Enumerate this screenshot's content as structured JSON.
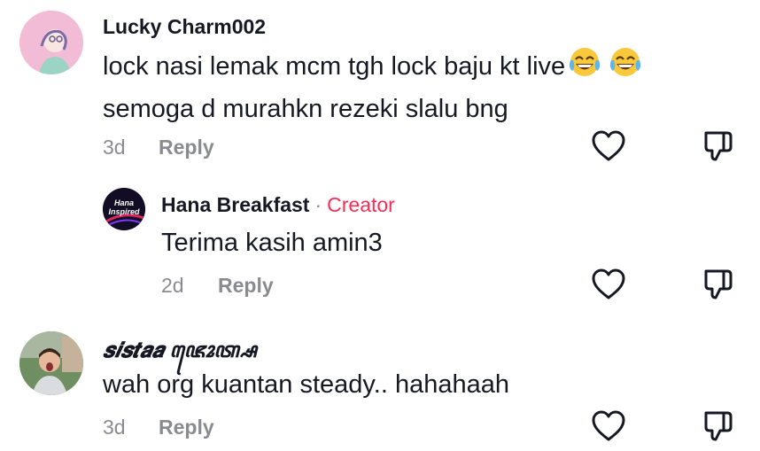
{
  "comments": [
    {
      "username": "Lucky Charm002",
      "text_line1": "lock nasi lemak mcm tgh lock baju kt live",
      "text_line2": "semoga d murahkn rezeki slalu bng",
      "emoji": "😂😂",
      "age": "3d",
      "reply_label": "Reply",
      "avatar_icon": "profile-avatar"
    },
    {
      "username": "Hana Breakfast",
      "separator": "·",
      "badge": "Creator",
      "text": "Terima kasih amin3",
      "age": "2d",
      "reply_label": "Reply",
      "avatar_text_line1": "Hana",
      "avatar_text_line2": "Inspired",
      "avatar_icon": "brand-avatar"
    },
    {
      "username": "𝒔𝒊𝒔𝒕𝒂𝒂 ꦗꦺꦴꦠ꧀ꦱ",
      "text": "wah org kuantan steady.. hahahaah",
      "age": "3d",
      "reply_label": "Reply",
      "avatar_icon": "photo-avatar"
    }
  ],
  "colors": {
    "creator_accent": "#fe2c55",
    "secondary_text": "#8a8b91"
  }
}
